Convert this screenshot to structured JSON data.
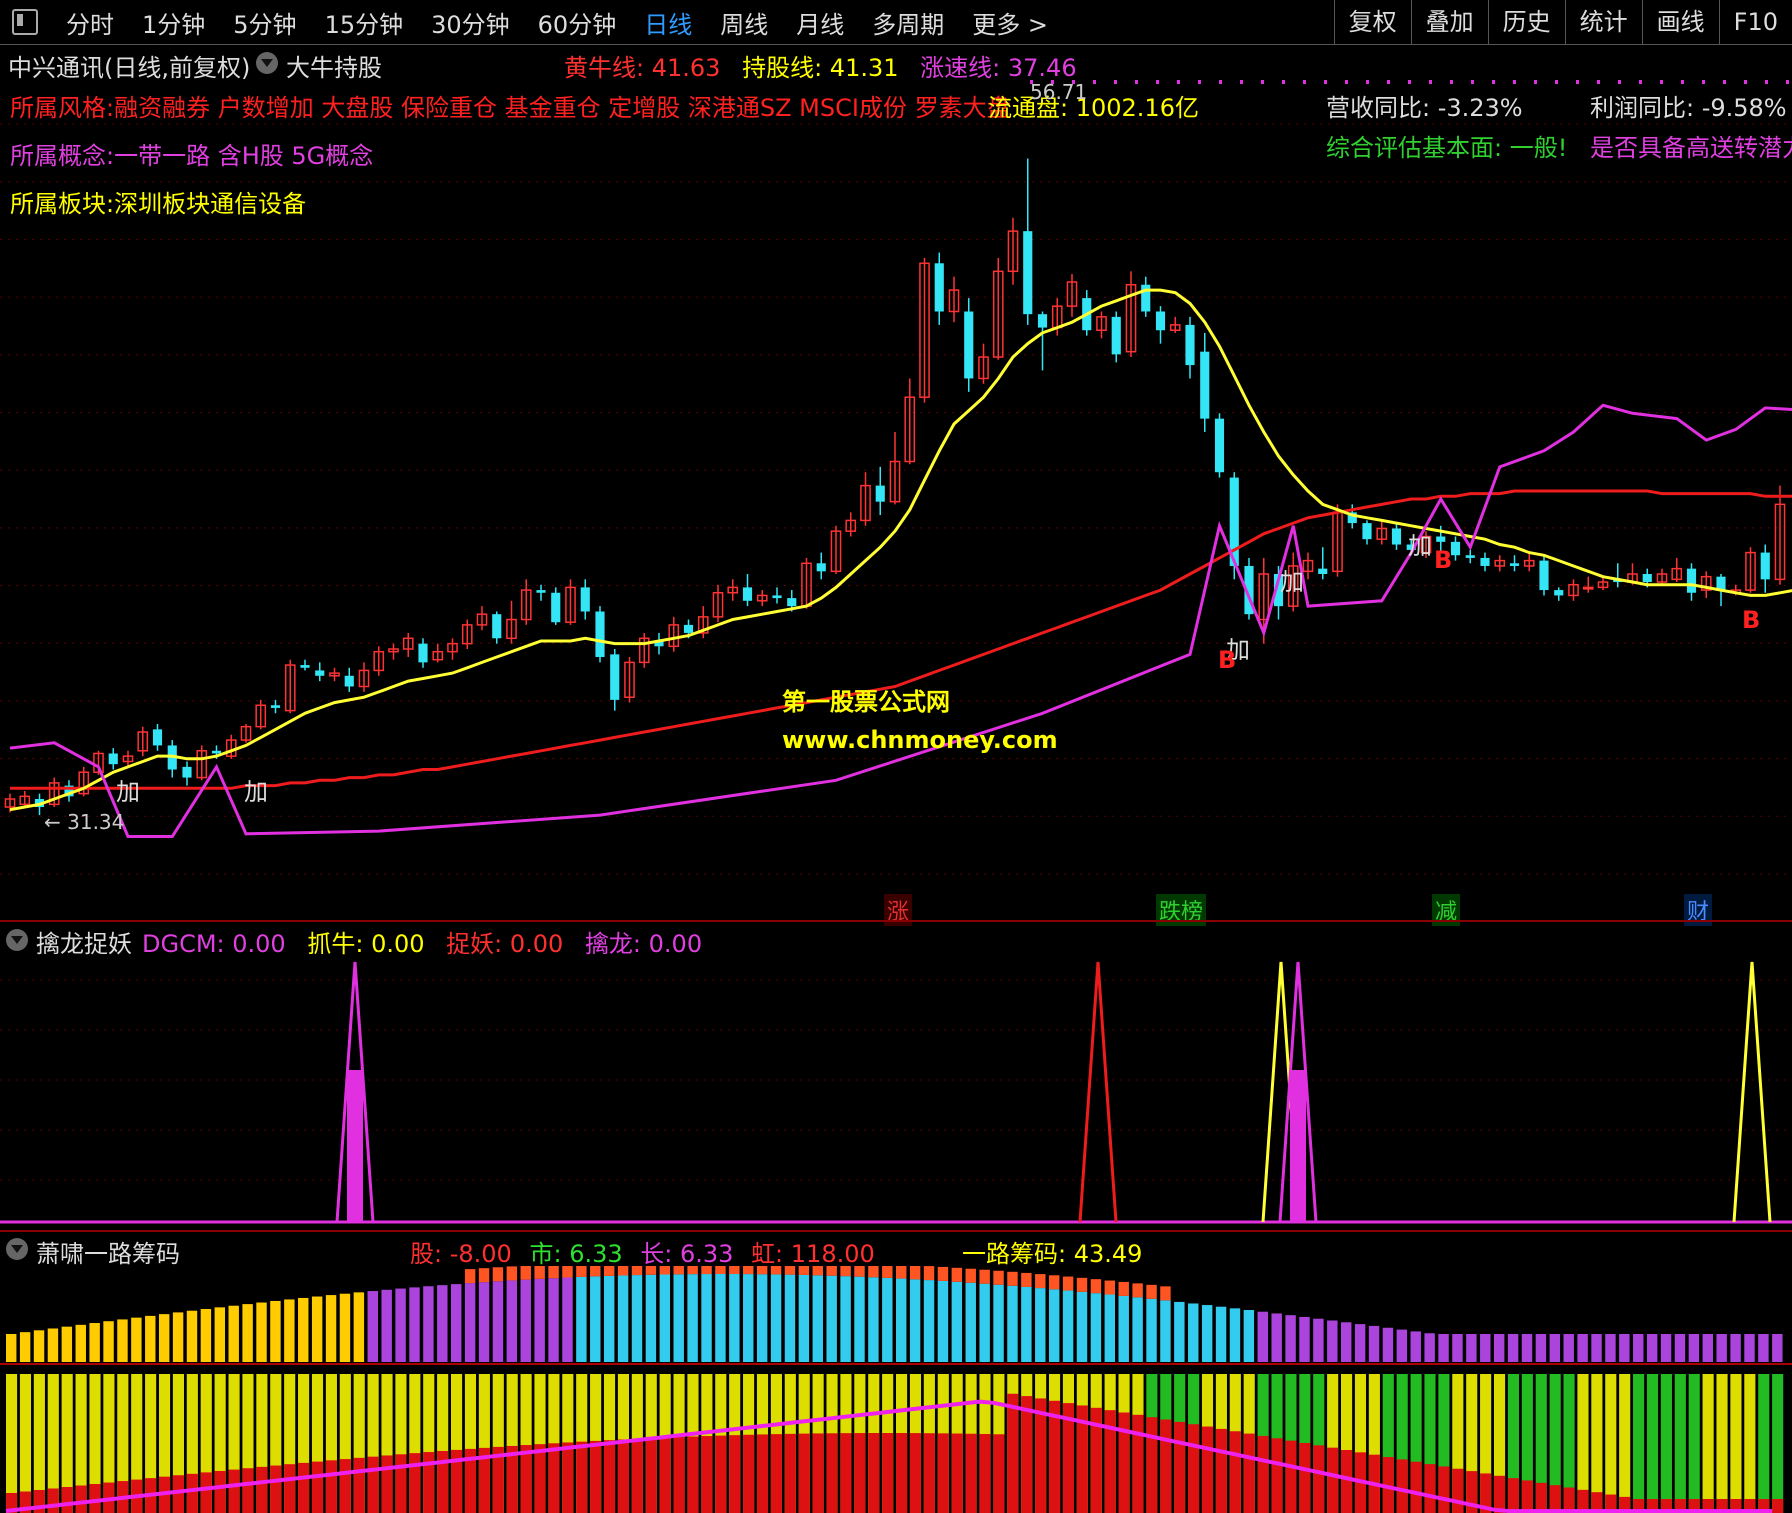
{
  "toolbar": {
    "periods": [
      "分时",
      "1分钟",
      "5分钟",
      "15分钟",
      "30分钟",
      "60分钟",
      "日线",
      "周线",
      "月线",
      "多周期",
      "更多 >"
    ],
    "active_index": 6,
    "right": [
      "复权",
      "叠加",
      "历史",
      "统计",
      "画线",
      "F10"
    ]
  },
  "main": {
    "stock_title": "中兴通讯(日线,前复权)",
    "formula_name": "大牛持股",
    "indicators": [
      {
        "label": "黄牛线: ",
        "value": "41.63"
      },
      {
        "label": "持股线: ",
        "value": "41.31"
      },
      {
        "label": "涨速线: ",
        "value": "37.46"
      }
    ],
    "style_line": "所属风格:融资融券 户数增加 大盘股 保险重仓 基金重仓 定增股 深港通SZ MSCI成份 罗素大盘",
    "float_cap": "流通盘: 1002.16亿",
    "high_price": "56.71",
    "concept_line": "所属概念:一带一路 含H股 5G概念",
    "sector_line": "所属板块:深圳板块通信设备",
    "revenue_yoy": "营收同比: -3.23%",
    "profit_yoy": "利润同比: -9.58%",
    "assessment_prefix": "综合评估基本面: 一般!",
    "assessment_suffix": "是否具备高送转潜力",
    "low_price": "31.34",
    "watermark_cn": "第一股票公式网",
    "watermark_url": "www.chnmoney.com",
    "signals": {
      "add": "加",
      "buy": "B",
      "minus": "减"
    },
    "event_tags": [
      {
        "text": "涨",
        "color": "#e03030",
        "bg": "#3a0000"
      },
      {
        "text": "跌榜",
        "color": "#30d030",
        "bg": "#003a00"
      },
      {
        "text": "减",
        "color": "#30d030",
        "bg": "#003a00"
      },
      {
        "text": "财",
        "color": "#4a8cff",
        "bg": "#001a40"
      }
    ]
  },
  "panel2": {
    "title": "擒龙捉妖",
    "indicators": [
      {
        "label": "DGCM: ",
        "value": "0.00",
        "color": "#e040e0"
      },
      {
        "label": "抓牛: ",
        "value": "0.00",
        "color": "#ffff00"
      },
      {
        "label": "捉妖: ",
        "value": "0.00",
        "color": "#ff3030"
      },
      {
        "label": "擒龙: ",
        "value": "0.00",
        "color": "#e040e0"
      }
    ]
  },
  "panel3": {
    "title": "萧啸一路筹码",
    "indicators": [
      {
        "label": "股: ",
        "value": "-8.00",
        "color": "#ff3030"
      },
      {
        "label": "市: ",
        "value": "6.33",
        "color": "#30e030"
      },
      {
        "label": "长: ",
        "value": "6.33",
        "color": "#e040e0"
      },
      {
        "label": "虹: ",
        "value": "118.00",
        "color": "#ff3030"
      }
    ],
    "chip_label": "一路筹码: ",
    "chip_value": "43.49"
  },
  "chart_data": {
    "type": "candlestick",
    "ylim": [
      30,
      58
    ],
    "candles": [
      [
        32.5,
        32.8,
        32.3,
        33.0
      ],
      [
        32.6,
        32.9,
        32.5,
        33.1
      ],
      [
        32.8,
        32.5,
        32.2,
        33.0
      ],
      [
        32.6,
        33.4,
        32.5,
        33.6
      ],
      [
        33.3,
        32.9,
        32.7,
        33.5
      ],
      [
        33.0,
        33.8,
        32.9,
        34.0
      ],
      [
        33.8,
        34.5,
        33.7,
        34.6
      ],
      [
        34.5,
        34.1,
        33.9,
        34.7
      ],
      [
        34.2,
        34.4,
        34.0,
        34.6
      ],
      [
        34.6,
        35.3,
        34.4,
        35.5
      ],
      [
        35.4,
        34.8,
        34.6,
        35.6
      ],
      [
        34.8,
        33.9,
        33.6,
        35.0
      ],
      [
        34.0,
        33.6,
        33.3,
        34.2
      ],
      [
        33.6,
        34.6,
        33.5,
        34.8
      ],
      [
        34.6,
        34.5,
        34.3,
        34.8
      ],
      [
        34.4,
        35.0,
        34.3,
        35.2
      ],
      [
        35.0,
        35.5,
        34.9,
        35.6
      ],
      [
        35.5,
        36.3,
        35.4,
        36.5
      ],
      [
        36.3,
        36.2,
        36.0,
        36.5
      ],
      [
        36.1,
        37.8,
        36.0,
        38.0
      ],
      [
        37.8,
        37.7,
        37.6,
        38.0
      ],
      [
        37.6,
        37.4,
        37.2,
        37.9
      ],
      [
        37.4,
        37.5,
        37.2,
        37.7
      ],
      [
        37.4,
        37.0,
        36.8,
        37.7
      ],
      [
        37.0,
        37.6,
        36.8,
        37.9
      ],
      [
        37.6,
        38.3,
        37.4,
        38.5
      ],
      [
        38.3,
        38.4,
        38.0,
        38.6
      ],
      [
        38.4,
        38.8,
        38.1,
        39.0
      ],
      [
        38.6,
        37.9,
        37.7,
        38.8
      ],
      [
        38.0,
        38.3,
        37.9,
        38.6
      ],
      [
        38.3,
        38.6,
        38.0,
        38.8
      ],
      [
        38.6,
        39.3,
        38.4,
        39.5
      ],
      [
        39.3,
        39.7,
        39.1,
        40.0
      ],
      [
        39.7,
        38.8,
        38.6,
        39.8
      ],
      [
        38.8,
        39.5,
        38.6,
        40.2
      ],
      [
        39.5,
        40.6,
        39.3,
        41.0
      ],
      [
        40.6,
        40.5,
        40.2,
        40.8
      ],
      [
        40.5,
        39.4,
        39.3,
        40.7
      ],
      [
        39.4,
        40.7,
        39.3,
        41.0
      ],
      [
        40.7,
        39.8,
        39.5,
        41.0
      ],
      [
        39.8,
        38.1,
        37.9,
        40.0
      ],
      [
        38.2,
        36.5,
        36.1,
        38.4
      ],
      [
        36.6,
        37.9,
        36.4,
        38.1
      ],
      [
        37.9,
        38.8,
        37.7,
        39.0
      ],
      [
        38.7,
        38.5,
        38.2,
        39.0
      ],
      [
        38.5,
        39.3,
        38.3,
        39.6
      ],
      [
        39.3,
        39.0,
        38.8,
        39.5
      ],
      [
        39.0,
        39.6,
        38.8,
        40.0
      ],
      [
        39.6,
        40.5,
        39.4,
        40.8
      ],
      [
        40.5,
        40.7,
        40.2,
        41.0
      ],
      [
        40.7,
        40.2,
        40.0,
        41.2
      ],
      [
        40.2,
        40.4,
        40.0,
        40.6
      ],
      [
        40.4,
        40.3,
        40.1,
        40.7
      ],
      [
        40.3,
        40.0,
        39.8,
        40.6
      ],
      [
        40.0,
        41.6,
        39.9,
        41.8
      ],
      [
        41.6,
        41.3,
        41.0,
        42.0
      ],
      [
        41.3,
        42.8,
        41.2,
        43.0
      ],
      [
        42.8,
        43.2,
        42.6,
        43.5
      ],
      [
        43.2,
        44.5,
        43.0,
        45.0
      ],
      [
        44.5,
        43.9,
        43.4,
        45.2
      ],
      [
        43.9,
        45.4,
        43.8,
        46.5
      ],
      [
        45.4,
        47.8,
        45.3,
        48.5
      ],
      [
        47.8,
        52.8,
        47.6,
        53.0
      ],
      [
        52.8,
        51.0,
        50.5,
        53.2
      ],
      [
        51.0,
        51.8,
        50.6,
        52.3
      ],
      [
        51.0,
        48.5,
        48.0,
        51.5
      ],
      [
        48.5,
        49.3,
        48.3,
        49.8
      ],
      [
        49.3,
        52.5,
        49.2,
        53.0
      ],
      [
        52.5,
        54.0,
        52.0,
        54.5
      ],
      [
        54.0,
        50.9,
        50.5,
        56.71
      ],
      [
        50.9,
        50.4,
        48.8,
        51.0
      ],
      [
        50.4,
        51.2,
        50.1,
        51.5
      ],
      [
        51.2,
        52.1,
        50.8,
        52.4
      ],
      [
        51.5,
        50.3,
        50.1,
        51.8
      ],
      [
        50.3,
        50.8,
        50.0,
        51.0
      ],
      [
        50.8,
        49.4,
        49.1,
        51.0
      ],
      [
        49.5,
        52.0,
        49.3,
        52.5
      ],
      [
        52.0,
        51.0,
        50.8,
        52.3
      ],
      [
        51.0,
        50.3,
        49.8,
        51.2
      ],
      [
        50.3,
        50.5,
        50.2,
        50.8
      ],
      [
        50.5,
        49.0,
        48.5,
        50.8
      ],
      [
        49.5,
        47.0,
        46.5,
        50.2
      ],
      [
        47.0,
        45.0,
        44.8,
        47.2
      ],
      [
        44.8,
        41.5,
        41.0,
        45.0
      ],
      [
        41.5,
        39.7,
        39.5,
        41.8
      ],
      [
        39.5,
        41.2,
        38.6,
        41.8
      ],
      [
        41.2,
        40.0,
        39.5,
        41.5
      ],
      [
        40.0,
        41.5,
        39.8,
        42.0
      ],
      [
        41.3,
        41.7,
        41.0,
        42.0
      ],
      [
        41.4,
        41.2,
        41.0,
        42.2
      ],
      [
        41.3,
        43.5,
        41.1,
        43.8
      ],
      [
        43.5,
        43.1,
        42.9,
        43.8
      ],
      [
        43.1,
        42.5,
        42.3,
        43.2
      ],
      [
        42.5,
        42.9,
        42.3,
        43.2
      ],
      [
        42.9,
        42.3,
        42.1,
        43.1
      ],
      [
        42.3,
        42.1,
        41.9,
        42.5
      ],
      [
        42.0,
        42.6,
        41.8,
        42.8
      ],
      [
        42.6,
        42.4,
        42.0,
        43.0
      ],
      [
        42.4,
        41.9,
        41.7,
        42.6
      ],
      [
        41.9,
        41.8,
        41.6,
        42.1
      ],
      [
        41.8,
        41.5,
        41.3,
        42.0
      ],
      [
        41.5,
        41.7,
        41.3,
        41.9
      ],
      [
        41.6,
        41.5,
        41.3,
        41.9
      ],
      [
        41.5,
        41.7,
        41.3,
        42.0
      ],
      [
        41.7,
        40.6,
        40.4,
        41.9
      ],
      [
        40.6,
        40.4,
        40.2,
        40.7
      ],
      [
        40.4,
        40.8,
        40.2,
        41.0
      ],
      [
        40.7,
        40.7,
        40.5,
        41.1
      ],
      [
        40.7,
        40.9,
        40.6,
        41.1
      ],
      [
        41.0,
        40.9,
        40.7,
        41.6
      ],
      [
        40.9,
        41.2,
        40.8,
        41.6
      ],
      [
        41.2,
        40.9,
        40.7,
        41.4
      ],
      [
        40.9,
        41.2,
        40.8,
        41.4
      ],
      [
        41.0,
        41.4,
        40.9,
        41.8
      ],
      [
        41.4,
        40.5,
        40.2,
        41.6
      ],
      [
        40.6,
        41.1,
        40.3,
        41.3
      ],
      [
        41.1,
        40.6,
        40.0,
        41.2
      ],
      [
        40.5,
        40.6,
        40.4,
        40.8
      ],
      [
        40.6,
        42.0,
        40.5,
        42.2
      ],
      [
        42.0,
        41.0,
        40.5,
        42.3
      ],
      [
        41.0,
        43.8,
        40.8,
        44.5
      ]
    ],
    "ma_yellow": [
      32.4,
      32.5,
      32.6,
      32.8,
      33.0,
      33.2,
      33.5,
      33.8,
      34.0,
      34.2,
      34.4,
      34.4,
      34.3,
      34.3,
      34.4,
      34.6,
      34.8,
      35.1,
      35.4,
      35.7,
      36.0,
      36.2,
      36.4,
      36.5,
      36.6,
      36.8,
      37.0,
      37.2,
      37.3,
      37.4,
      37.5,
      37.7,
      37.9,
      38.1,
      38.3,
      38.5,
      38.7,
      38.7,
      38.7,
      38.8,
      38.7,
      38.6,
      38.6,
      38.6,
      38.7,
      38.8,
      38.9,
      39.1,
      39.3,
      39.5,
      39.6,
      39.7,
      39.8,
      39.9,
      40.0,
      40.3,
      40.7,
      41.2,
      41.7,
      42.2,
      42.8,
      43.6,
      44.7,
      45.8,
      46.8,
      47.3,
      47.8,
      48.5,
      49.3,
      49.8,
      50.2,
      50.4,
      50.6,
      50.9,
      51.2,
      51.4,
      51.6,
      51.8,
      51.8,
      51.7,
      51.3,
      50.6,
      49.7,
      48.6,
      47.5,
      46.5,
      45.6,
      44.9,
      44.3,
      43.8,
      43.6,
      43.4,
      43.3,
      43.2,
      43.1,
      43.0,
      42.9,
      42.8,
      42.7,
      42.6,
      42.5,
      42.3,
      42.2,
      42.0,
      41.9,
      41.7,
      41.5,
      41.3,
      41.1,
      41.0,
      40.9,
      40.8,
      40.8,
      40.8,
      40.8,
      40.7,
      40.6,
      40.5,
      40.4,
      40.4,
      40.5,
      40.6,
      40.8,
      41.0
    ],
    "ma_red": [
      33.2,
      33.2,
      33.2,
      33.2,
      33.2,
      33.2,
      33.2,
      33.2,
      33.2,
      33.2,
      33.2,
      33.2,
      33.2,
      33.2,
      33.2,
      33.2,
      33.3,
      33.3,
      33.3,
      33.4,
      33.4,
      33.5,
      33.5,
      33.6,
      33.6,
      33.7,
      33.7,
      33.8,
      33.9,
      33.9,
      34.0,
      34.1,
      34.2,
      34.3,
      34.4,
      34.5,
      34.6,
      34.7,
      34.8,
      34.9,
      35.0,
      35.1,
      35.2,
      35.3,
      35.4,
      35.5,
      35.6,
      35.7,
      35.8,
      35.9,
      36.0,
      36.1,
      36.2,
      36.3,
      36.4,
      36.5,
      36.6,
      36.7,
      36.8,
      36.9,
      37.0,
      37.2,
      37.4,
      37.6,
      37.8,
      38.0,
      38.2,
      38.4,
      38.6,
      38.8,
      39.0,
      39.2,
      39.4,
      39.6,
      39.8,
      40.0,
      40.2,
      40.4,
      40.6,
      40.9,
      41.2,
      41.5,
      41.8,
      42.1,
      42.4,
      42.7,
      42.9,
      43.1,
      43.3,
      43.4,
      43.5,
      43.6,
      43.7,
      43.8,
      43.9,
      44.0,
      44.0,
      44.1,
      44.1,
      44.2,
      44.2,
      44.2,
      44.3,
      44.3,
      44.3,
      44.3,
      44.3,
      44.3,
      44.3,
      44.3,
      44.3,
      44.3,
      44.2,
      44.2,
      44.2,
      44.2,
      44.2,
      44.2,
      44.2,
      44.1,
      44.1,
      44.1,
      44.1
    ],
    "magenta": [
      [
        0,
        34.7
      ],
      [
        3,
        34.9
      ],
      [
        6,
        34.0
      ],
      [
        8,
        31.4
      ],
      [
        11,
        31.4
      ],
      [
        14,
        34.0
      ],
      [
        16,
        31.5
      ],
      [
        25,
        31.6
      ],
      [
        40,
        32.2
      ],
      [
        56,
        33.5
      ],
      [
        70,
        36.0
      ],
      [
        80,
        38.2
      ],
      [
        82,
        43.0
      ],
      [
        85,
        39.0
      ],
      [
        87,
        43.0
      ],
      [
        88,
        40.0
      ],
      [
        93,
        40.2
      ],
      [
        95,
        42.0
      ],
      [
        97,
        44.0
      ],
      [
        99,
        42.2
      ],
      [
        101,
        45.2
      ],
      [
        104,
        45.8
      ],
      [
        106,
        46.5
      ],
      [
        108,
        47.5
      ],
      [
        110,
        47.2
      ],
      [
        113,
        47.0
      ],
      [
        115,
        46.2
      ],
      [
        117,
        46.6
      ],
      [
        119,
        47.4
      ],
      [
        122,
        47.3
      ],
      [
        123,
        45.2
      ],
      [
        124,
        43.5
      ],
      [
        125,
        42.5
      ]
    ]
  }
}
